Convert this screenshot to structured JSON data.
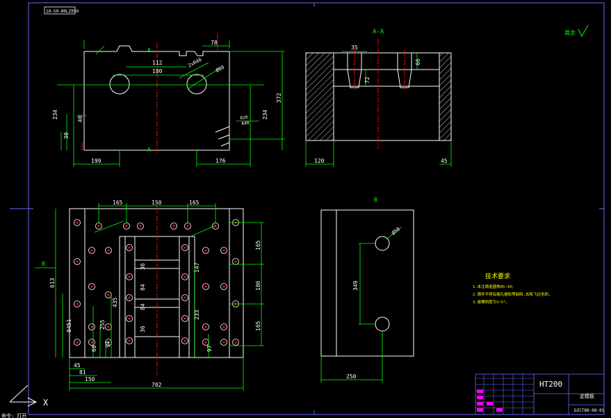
{
  "header_tag": "10-50-00LZ950",
  "axis_marker": "X",
  "bottom_status": "命令: 打开",
  "dims": {
    "top_78": "78",
    "top_112": "112",
    "top_180": "180",
    "top_r40": "2xR40",
    "top_d80": "Ø80",
    "left_234": "234",
    "left_40": "40",
    "left_30": "30",
    "right_234": "234",
    "right_372": "372",
    "bot_199": "199",
    "bot_176": "176",
    "r20": "R20",
    "r40b": "R40",
    "sec_35": "35",
    "sec_66": "66",
    "sec_72": "72",
    "sec_120": "120",
    "sec_45": "45",
    "bl_165a": "165",
    "bl_150": "150",
    "bl_165b": "165",
    "bl_613": "613",
    "bl_8451": "8451",
    "bl_435": "435",
    "bl_255": "255",
    "bl_60": "60",
    "bl_94": "94",
    "bl_36a": "36",
    "bl_84a": "84",
    "bl_84b": "84",
    "bl_36b": "36",
    "bl_147": "147",
    "bl_233": "233",
    "bl_97": "97",
    "bl_r165a": "165",
    "bl_r186": "186",
    "bl_r165b": "165",
    "bl_45": "45",
    "bl_81": "81",
    "bl_150b": "150",
    "bl_702": "702",
    "br_d50": "Ø50",
    "br_349": "349",
    "br_250": "250"
  },
  "view_labels": {
    "section_top": "A-A",
    "a_upper": "A",
    "a_lower": "A",
    "b_left": "B",
    "b_right": "B",
    "roughness": "其余"
  },
  "tech_notes": {
    "title": "技术要求",
    "line1": "1.未注铸造圆角R5~10;",
    "line2": "2.铸件不得有缩孔缩松等缺陷,去除飞边毛刺,",
    "line3": "3.拔模斜度为1~5°。"
  },
  "title_block": {
    "material": "HT200",
    "part_name": "定模板",
    "drawing_no": "DZCT80-08-01"
  },
  "colors": {
    "background": "#000000",
    "outline": "#ffffff",
    "dimension": "#00ff00",
    "dim_text": "#ffffff",
    "centerline": "#ff0000",
    "hatch": "#ffffff",
    "frame": "#6a6aff",
    "notes": "#ffff00",
    "title_fill": "#ff00ff"
  }
}
